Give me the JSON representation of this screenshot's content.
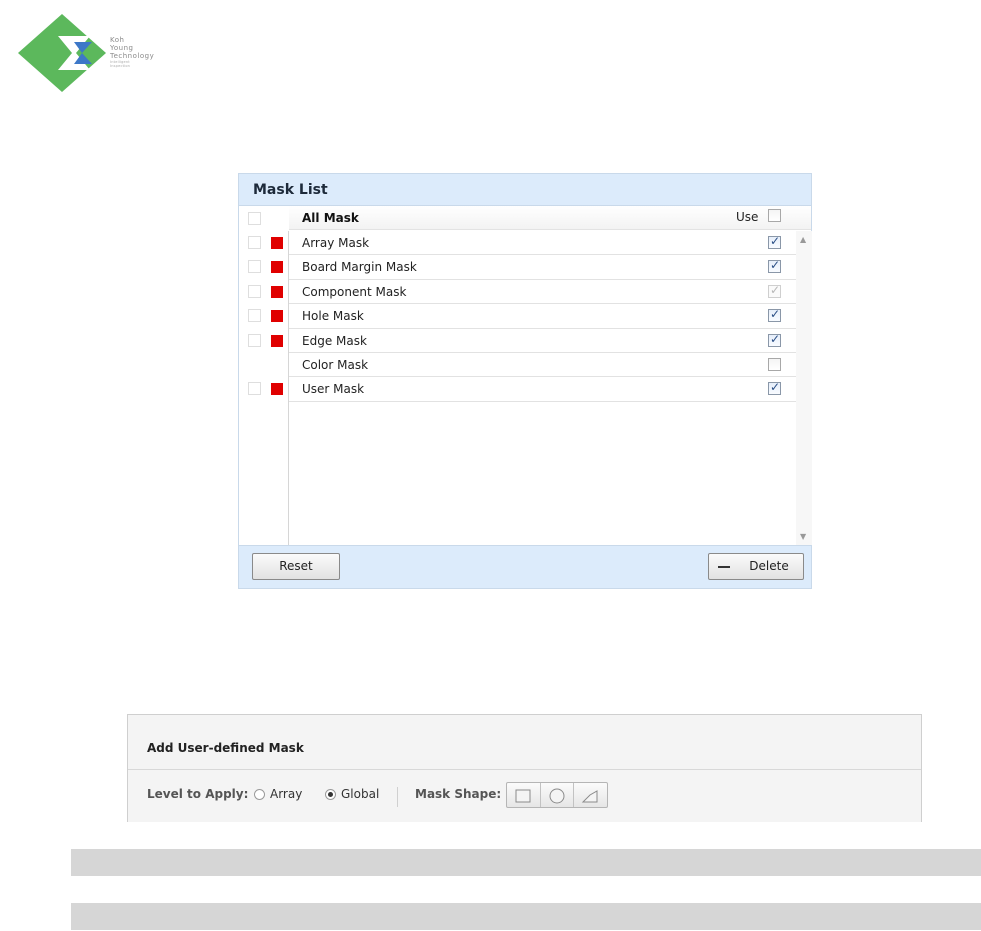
{
  "logo": {
    "line1": "Koh",
    "line2": "Young",
    "line3": "Technology",
    "tag1": "Intelligent",
    "tag2": "Inspection",
    "colors": {
      "green": "#5cb85c",
      "blue": "#3366aa"
    }
  },
  "mask_list": {
    "title": "Mask List",
    "header": {
      "name": "All Mask",
      "use_label": "Use",
      "use_checked": false
    },
    "rows": [
      {
        "name": "Array Mask",
        "swatch": true,
        "use": "checked"
      },
      {
        "name": "Board Margin Mask",
        "swatch": true,
        "use": "checked"
      },
      {
        "name": "Component Mask",
        "swatch": true,
        "use": "checked-disabled"
      },
      {
        "name": "Hole Mask",
        "swatch": true,
        "use": "checked"
      },
      {
        "name": "Edge Mask",
        "swatch": true,
        "use": "checked"
      },
      {
        "name": "Color Mask",
        "swatch": false,
        "use": "unchecked"
      },
      {
        "name": "User Mask",
        "swatch": true,
        "use": "checked"
      }
    ],
    "swatch_color": "#e00000",
    "reset_label": "Reset",
    "delete_label": "Delete"
  },
  "user_mask": {
    "title": "Add User-defined Mask",
    "level_label": "Level to Apply:",
    "options": {
      "array": "Array",
      "global": "Global"
    },
    "selected_level": "Global",
    "shape_label": "Mask Shape:",
    "shapes": [
      "rectangle-icon",
      "circle-icon",
      "polygon-icon"
    ]
  }
}
